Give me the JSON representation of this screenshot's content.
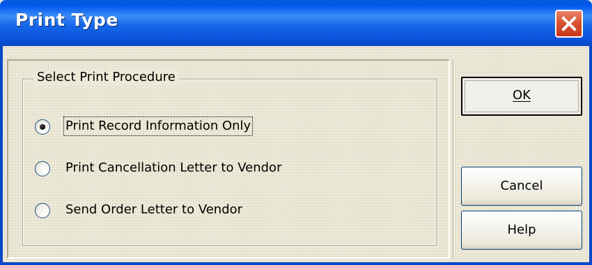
{
  "window": {
    "title": "Print Type"
  },
  "group": {
    "label": "Select Print Procedure"
  },
  "options": [
    {
      "label": "Print Record Information Only",
      "selected": true
    },
    {
      "label": "Print Cancellation Letter to Vendor",
      "selected": false
    },
    {
      "label": "Send Order Letter to Vendor",
      "selected": false
    }
  ],
  "buttons": {
    "ok": "OK",
    "cancel": "Cancel",
    "help": "Help"
  },
  "colors": {
    "titlebar": "#0058ee",
    "face": "#ece9d8",
    "close": "#d95431"
  },
  "icons": {
    "close": "close-icon"
  }
}
